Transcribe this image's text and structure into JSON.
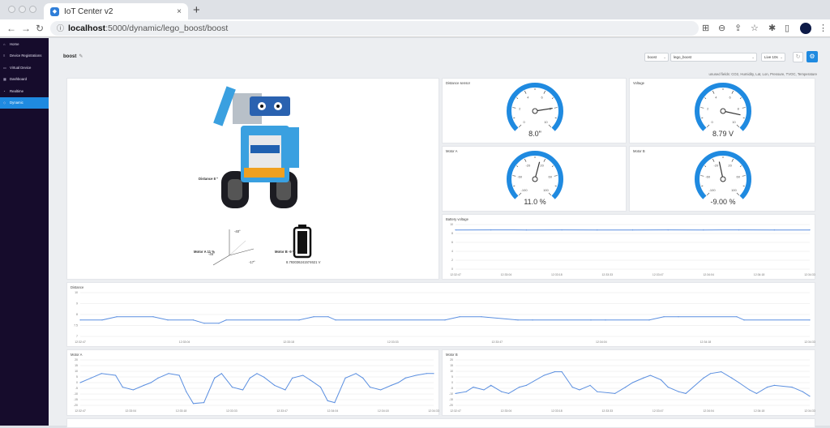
{
  "browser": {
    "tab_title": "IoT Center v2",
    "url_host": "localhost",
    "url_path": ":5000/dynamic/lego_boost/boost",
    "new_tab": "+",
    "close": "×"
  },
  "sidebar": {
    "items": [
      {
        "label": "Home",
        "icon": "home-icon",
        "glyph": "⌂"
      },
      {
        "label": "Device Registrations",
        "icon": "list-icon",
        "glyph": "≡"
      },
      {
        "label": "Virtual Device",
        "icon": "device-icon",
        "glyph": "▭"
      },
      {
        "label": "Dashboard",
        "icon": "dashboard-icon",
        "glyph": "▦"
      },
      {
        "label": "Realtime",
        "icon": "realtime-icon",
        "glyph": "◔"
      },
      {
        "label": "Dynamic",
        "icon": "dynamic-icon",
        "glyph": "◇",
        "active": true
      }
    ]
  },
  "header": {
    "title": "boost",
    "device_select": "boost",
    "dashboard_select": "lego_boost",
    "mode_select": "Live 10s",
    "unused_fields": "unused fields: CO2, Humidity, Lat, Lon, Pressure, TVOC, Temperature"
  },
  "robot_panel": {
    "distance_label": "Distance 8 \"",
    "motor_a_label": "Motor A 11 %",
    "motor_b_label": "Motor B -9 %",
    "tilt_angle_1": "-40°",
    "tilt_angle_2": "-45°",
    "tilt_angle_3": "-17°",
    "battery_value": "8.793036241574621 V"
  },
  "gauges": [
    {
      "title": "Distance sensor",
      "value": "8.0\"",
      "min": 0,
      "max": 10,
      "current": 8,
      "ticks": [
        "0",
        "2",
        "4",
        "6",
        "8",
        "10"
      ]
    },
    {
      "title": "Voltage",
      "value": "8.79 V",
      "min": 0,
      "max": 10,
      "current": 8.79,
      "ticks": [
        "0",
        "2",
        "4",
        "6",
        "8",
        "10"
      ]
    },
    {
      "title": "Motor A",
      "value": "11.0 %",
      "min": -100,
      "max": 100,
      "current": 11,
      "ticks": [
        "-100",
        "-60",
        "-20",
        "20",
        "60",
        "100"
      ]
    },
    {
      "title": "Motor B",
      "value": "-9.00 %",
      "min": -100,
      "max": 100,
      "current": -9,
      "ticks": [
        "-100",
        "-60",
        "-20",
        "20",
        "60",
        "100"
      ]
    }
  ],
  "chart_data": [
    {
      "type": "line",
      "title": "Battery voltage",
      "ylim": [
        0,
        10
      ],
      "yticks": [
        "10",
        "8",
        "6",
        "4",
        "2",
        "0"
      ],
      "xticks": [
        "12:32:47",
        "12:33:04",
        "12:33:18",
        "12:33:33",
        "12:33:47",
        "12:34:04",
        "12:34:18",
        "12:34:33"
      ],
      "x": [
        0,
        0.1,
        0.2,
        0.3,
        0.4,
        0.5,
        0.6,
        0.7,
        0.8,
        0.9,
        1
      ],
      "values": [
        8.79,
        8.8,
        8.79,
        8.8,
        8.79,
        8.79,
        8.8,
        8.79,
        8.8,
        8.79,
        8.79
      ]
    },
    {
      "type": "line",
      "title": "Distance",
      "ylim": [
        6.5,
        10.5
      ],
      "yticks": [
        "10",
        "9",
        "8",
        "7.5",
        "7"
      ],
      "xticks": [
        "12:32:47",
        "12:33:04",
        "12:33:18",
        "12:33:33",
        "12:33:47",
        "12:34:04",
        "12:34:18",
        "12:34:33"
      ],
      "x": [
        0,
        0.03,
        0.05,
        0.1,
        0.12,
        0.155,
        0.17,
        0.19,
        0.2,
        0.3,
        0.32,
        0.34,
        0.35,
        0.5,
        0.52,
        0.55,
        0.6,
        0.62,
        0.7,
        0.72,
        0.78,
        0.8,
        0.82,
        0.9,
        0.91,
        1
      ],
      "values": [
        8,
        8,
        8.3,
        8.3,
        8,
        8,
        7.7,
        7.7,
        8,
        8,
        8.3,
        8.3,
        8,
        8,
        8.3,
        8.3,
        8,
        8,
        8,
        8,
        8,
        8.3,
        8.3,
        8.3,
        8,
        8
      ]
    },
    {
      "type": "line",
      "title": "Motor A",
      "ylim": [
        -25,
        25
      ],
      "yticks": [
        "20",
        "15",
        "10",
        "5",
        "0",
        "-5",
        "-10",
        "-15",
        "-20"
      ],
      "xticks": [
        "12:32:47",
        "12:33:04",
        "12:33:18",
        "12:33:33",
        "12:33:47",
        "12:34:04",
        "12:34:18",
        "12:34:33"
      ],
      "x": [
        0,
        0.03,
        0.06,
        0.1,
        0.12,
        0.15,
        0.18,
        0.2,
        0.22,
        0.25,
        0.28,
        0.3,
        0.32,
        0.35,
        0.38,
        0.4,
        0.43,
        0.46,
        0.48,
        0.5,
        0.52,
        0.55,
        0.58,
        0.6,
        0.63,
        0.65,
        0.68,
        0.7,
        0.72,
        0.75,
        0.78,
        0.8,
        0.82,
        0.85,
        0.88,
        0.9,
        0.92,
        0.95,
        0.98,
        1
      ],
      "values": [
        0,
        5,
        10,
        8,
        -5,
        -8,
        -3,
        0,
        5,
        10,
        8,
        -10,
        -23,
        -22,
        5,
        10,
        -5,
        -8,
        5,
        10,
        6,
        -3,
        -8,
        5,
        8,
        3,
        -5,
        -20,
        -22,
        5,
        10,
        5,
        -5,
        -8,
        -3,
        0,
        5,
        8,
        10,
        10
      ]
    },
    {
      "type": "line",
      "title": "Motor B",
      "ylim": [
        -25,
        25
      ],
      "yticks": [
        "20",
        "15",
        "10",
        "5",
        "0",
        "-5",
        "-10",
        "-15",
        "-20"
      ],
      "xticks": [
        "12:32:47",
        "12:33:04",
        "12:33:18",
        "12:33:33",
        "12:33:47",
        "12:34:04",
        "12:34:18",
        "12:34:33"
      ],
      "x": [
        0,
        0.03,
        0.05,
        0.08,
        0.1,
        0.13,
        0.15,
        0.18,
        0.2,
        0.25,
        0.28,
        0.3,
        0.33,
        0.35,
        0.38,
        0.4,
        0.45,
        0.48,
        0.5,
        0.53,
        0.55,
        0.58,
        0.6,
        0.63,
        0.65,
        0.7,
        0.72,
        0.75,
        0.78,
        0.8,
        0.83,
        0.85,
        0.88,
        0.9,
        0.95,
        0.98,
        1
      ],
      "values": [
        -12,
        -10,
        -5,
        -8,
        -3,
        -10,
        -12,
        -5,
        -3,
        8,
        12,
        12,
        -5,
        -8,
        -3,
        -10,
        -12,
        -5,
        0,
        5,
        8,
        3,
        -5,
        -10,
        -12,
        5,
        10,
        12,
        5,
        0,
        -8,
        -12,
        -5,
        -3,
        -5,
        -10,
        -15
      ]
    }
  ]
}
